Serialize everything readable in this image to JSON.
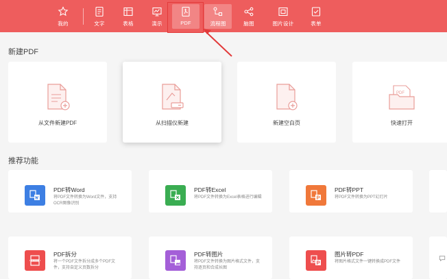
{
  "toolbar": {
    "items": [
      {
        "label": "我的",
        "icon": "star-icon"
      },
      {
        "label": "文字",
        "icon": "document-icon"
      },
      {
        "label": "表格",
        "icon": "table-icon"
      },
      {
        "label": "演示",
        "icon": "presentation-icon"
      },
      {
        "label": "PDF",
        "icon": "pdf-icon"
      },
      {
        "label": "流程图",
        "icon": "flowchart-icon"
      },
      {
        "label": "脑图",
        "icon": "mindmap-icon"
      },
      {
        "label": "图片设计",
        "icon": "image-design-icon"
      },
      {
        "label": "表单",
        "icon": "form-icon"
      }
    ],
    "active": "PDF",
    "bg_color": "#ee5d5d"
  },
  "new_section": {
    "title": "新建PDF",
    "cards": [
      {
        "label": "从文件新建PDF",
        "icon": "file-plus-icon"
      },
      {
        "label": "从扫描仪新建",
        "icon": "scanner-file-icon"
      },
      {
        "label": "新建空白页",
        "icon": "blank-page-plus-icon"
      },
      {
        "label": "快速打开",
        "icon": "pdf-folder-icon"
      }
    ]
  },
  "recommend_section": {
    "title": "推荐功能",
    "items": [
      {
        "title": "PDF转Word",
        "desc": "将PDF文件转换为Word文件，支持OCR图像识别",
        "color": "#3d7fe3",
        "icon": "pdf-to-word-icon"
      },
      {
        "title": "PDF转Excel",
        "desc": "将PDF文件转换为Excel表格进行编辑",
        "color": "#3aad52",
        "icon": "pdf-to-excel-icon"
      },
      {
        "title": "PDF转PPT",
        "desc": "将PDF文件转换为PPT幻灯片",
        "color": "#f0783a",
        "icon": "pdf-to-ppt-icon"
      },
      {
        "title": "PDF拆分",
        "desc": "将一个PDF文件拆分成多个PDF文件，支持自定义页数拆分",
        "color": "#ee4e4e",
        "icon": "pdf-split-icon"
      },
      {
        "title": "PDF转图片",
        "desc": "将PDF文件转换为图片格式文件，支持逐页和合成长图",
        "color": "#a45fd8",
        "icon": "pdf-to-image-icon"
      },
      {
        "title": "图片转PDF",
        "desc": "将图片格式文件一键转换成PDF文件",
        "color": "#ee4e4e",
        "icon": "image-to-pdf-icon"
      }
    ]
  }
}
